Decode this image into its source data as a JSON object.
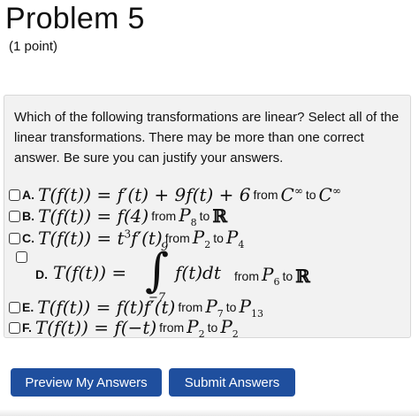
{
  "header": {
    "title": "Problem 5",
    "points": "(1 point)"
  },
  "question": "Which of the following transformations are linear? Select all of the linear transformations. There may be more than one correct answer. Be sure you can justify your answers.",
  "options": [
    {
      "letter": "A.",
      "lhs": "T(f(t)) = f′(t) + 9f(t) + 6",
      "from_label": "from",
      "domain": "C",
      "domain_sup": "∞",
      "to_label": "to",
      "codomain": "C",
      "codomain_sup": "∞"
    },
    {
      "letter": "B.",
      "lhs": "T(f(t)) = f(4)",
      "from_label": "from",
      "domain": "P",
      "domain_sub": "8",
      "to_label": "to",
      "codomain": "ℝ"
    },
    {
      "letter": "C.",
      "lhs_pre": "T(f(t)) = t",
      "lhs_sup": "3",
      "lhs_post": "f′(t)",
      "from_label": "from",
      "domain": "P",
      "domain_sub": "2",
      "to_label": "to",
      "codomain": "P",
      "codomain_sub": "4"
    },
    {
      "letter": "D.",
      "lhs": "T(f(t)) =",
      "integral_upper": "9",
      "integral_lower": "−7",
      "integrand": "f(t)dt",
      "from_label": "from",
      "domain": "P",
      "domain_sub": "6",
      "to_label": "to",
      "codomain": "ℝ"
    },
    {
      "letter": "E.",
      "lhs": "T(f(t)) = f(t)f′(t)",
      "from_label": "from",
      "domain": "P",
      "domain_sub": "7",
      "to_label": "to",
      "codomain": "P",
      "codomain_sub": "13"
    },
    {
      "letter": "F.",
      "lhs": "T(f(t)) = f(−t)",
      "from_label": "from",
      "domain": "P",
      "domain_sub": "2",
      "to_label": "to",
      "codomain": "P",
      "codomain_sub": "2"
    }
  ],
  "buttons": {
    "preview": "Preview My Answers",
    "submit": "Submit Answers"
  },
  "colors": {
    "button_bg": "#1f4f9e",
    "box_bg": "#f2f2f2"
  }
}
